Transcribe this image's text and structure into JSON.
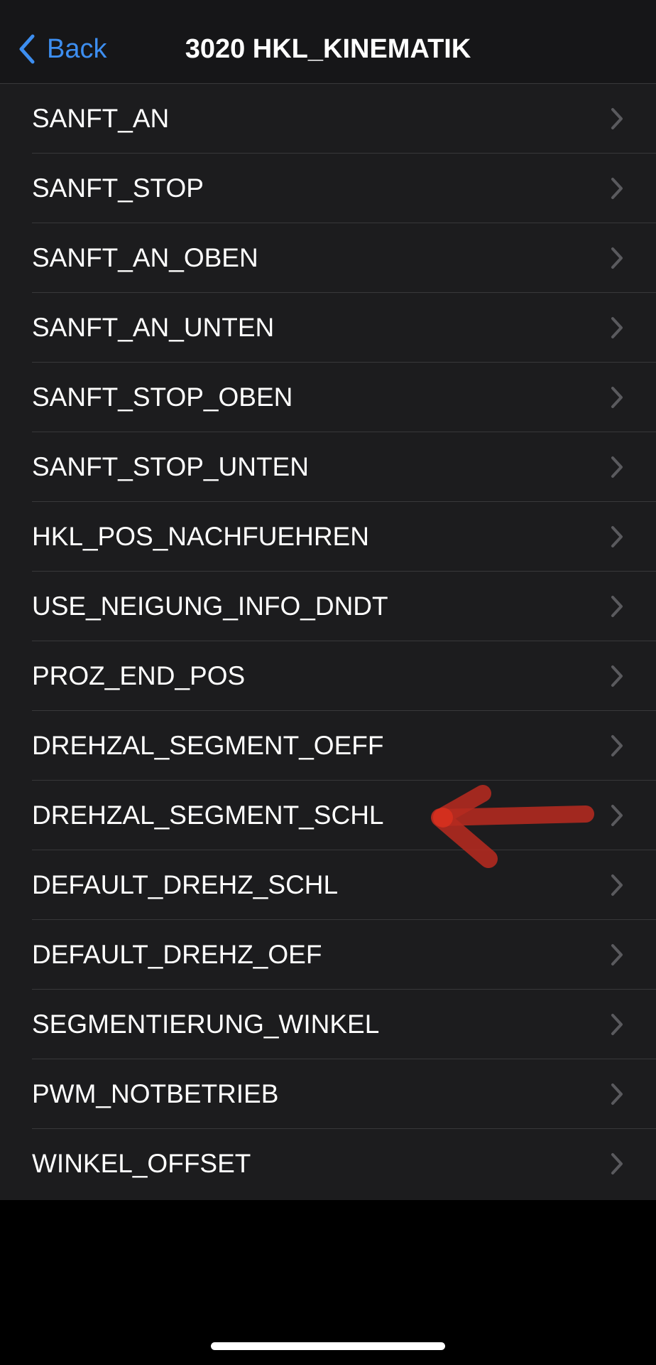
{
  "nav": {
    "back_label": "Back",
    "title": "3020 HKL_KINEMATIK",
    "back_icon": "chevron-left-icon",
    "accent_color": "#3d8ef0"
  },
  "list": {
    "items": [
      {
        "label": "SANFT_AN"
      },
      {
        "label": "SANFT_STOP"
      },
      {
        "label": "SANFT_AN_OBEN"
      },
      {
        "label": "SANFT_AN_UNTEN"
      },
      {
        "label": "SANFT_STOP_OBEN"
      },
      {
        "label": "SANFT_STOP_UNTEN"
      },
      {
        "label": "HKL_POS_NACHFUEHREN"
      },
      {
        "label": "USE_NEIGUNG_INFO_DNDT"
      },
      {
        "label": "PROZ_END_POS"
      },
      {
        "label": "DREHZAL_SEGMENT_OEFF"
      },
      {
        "label": "DREHZAL_SEGMENT_SCHL"
      },
      {
        "label": "DEFAULT_DREHZ_SCHL"
      },
      {
        "label": "DEFAULT_DREHZ_OEF"
      },
      {
        "label": "SEGMENTIERUNG_WINKEL"
      },
      {
        "label": "PWM_NOTBETRIEB"
      },
      {
        "label": "WINKEL_OFFSET"
      }
    ],
    "row_icon": "chevron-right-icon"
  },
  "annotation": {
    "icon": "red-arrow-annotation-icon",
    "color": "#c0281e",
    "points_to_item": "DREHZAL_SEGMENT_SCHL"
  }
}
